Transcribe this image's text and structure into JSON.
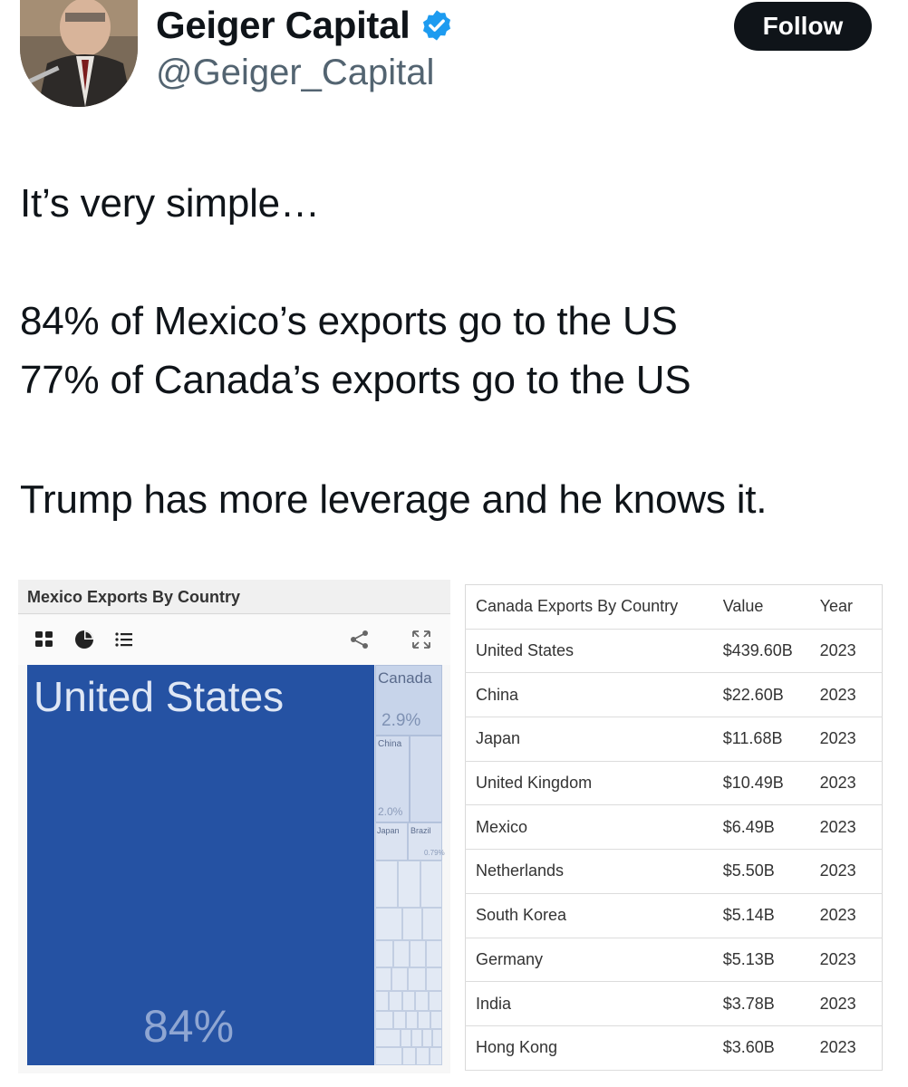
{
  "header": {
    "display_name": "Geiger Capital",
    "handle": "@Geiger_Capital",
    "follow_label": "Follow"
  },
  "tweet": {
    "lines": [
      "It’s very simple…",
      "84% of Mexico’s exports go to the US",
      "77% of Canada’s exports go to the US",
      "Trump has more leverage and he knows it."
    ]
  },
  "mexico_chart": {
    "title": "Mexico Exports By Country",
    "toolbar_icons": [
      "grid-view-icon",
      "pie-chart-icon",
      "list-view-icon",
      "share-icon",
      "expand-icon"
    ],
    "colors": {
      "primary": "#2552a3",
      "secondary": "#c7d4ea"
    }
  },
  "chart_data": {
    "type": "treemap",
    "title": "Mexico Exports By Country",
    "items": [
      {
        "label": "United States",
        "value_label": "84%",
        "value": 84
      },
      {
        "label": "Canada",
        "value_label": "2.9%",
        "value": 2.9
      },
      {
        "label": "China",
        "value_label": "2.0%",
        "value": 2.0
      },
      {
        "label": "Japan",
        "value_label": "",
        "value": null
      },
      {
        "label": "Brazil",
        "value_label": "0.79%",
        "value": 0.79
      }
    ]
  },
  "canada_table": {
    "headers": [
      "Canada Exports By Country",
      "Value",
      "Year"
    ],
    "rows": [
      [
        "United States",
        "$439.60B",
        "2023"
      ],
      [
        "China",
        "$22.60B",
        "2023"
      ],
      [
        "Japan",
        "$11.68B",
        "2023"
      ],
      [
        "United Kingdom",
        "$10.49B",
        "2023"
      ],
      [
        "Mexico",
        "$6.49B",
        "2023"
      ],
      [
        "Netherlands",
        "$5.50B",
        "2023"
      ],
      [
        "South Korea",
        "$5.14B",
        "2023"
      ],
      [
        "Germany",
        "$5.13B",
        "2023"
      ],
      [
        "India",
        "$3.78B",
        "2023"
      ],
      [
        "Hong Kong",
        "$3.60B",
        "2023"
      ]
    ]
  }
}
